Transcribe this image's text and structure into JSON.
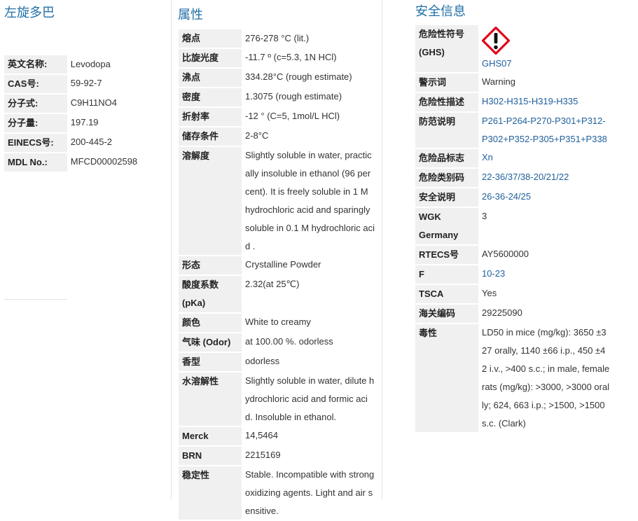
{
  "left": {
    "title": "左旋多巴",
    "rows": [
      {
        "k": "英文名称:",
        "v": "Levodopa"
      },
      {
        "k": "CAS号:",
        "v": "59-92-7"
      },
      {
        "k": "分子式:",
        "v": "C9H11NO4"
      },
      {
        "k": "分子量:",
        "v": "197.19"
      },
      {
        "k": "EINECS号:",
        "v": "200-445-2"
      },
      {
        "k": "MDL No.:",
        "v": "MFCD00002598"
      }
    ]
  },
  "middle": {
    "title": "属性",
    "rows": [
      {
        "k": "熔点",
        "v": "276-278 °C (lit.)"
      },
      {
        "k": "比旋光度",
        "v": "-11.7 º (c=5.3, 1N HCl)"
      },
      {
        "k": "沸点",
        "v": "334.28°C (rough estimate)"
      },
      {
        "k": "密度",
        "v": "1.3075 (rough estimate)"
      },
      {
        "k": "折射率",
        "v": "-12 ° (C=5, 1mol/L HCl)"
      },
      {
        "k": "储存条件",
        "v": "2-8°C"
      },
      {
        "k": "溶解度",
        "v": "Slightly soluble in water, practically insoluble in ethanol (96 per cent). It is freely soluble in 1 M hydrochloric acid and sparingly soluble in 0.1 M hydrochloric acid ."
      },
      {
        "k": "形态",
        "v": "Crystalline Powder"
      },
      {
        "k": "酸度系数(pKa)",
        "v": "2.32(at 25℃)"
      },
      {
        "k": "颜色",
        "v": "White to creamy"
      },
      {
        "k": "气味 (Odor)",
        "v": "at 100.00 %. odorless"
      },
      {
        "k": "香型",
        "v": "odorless"
      },
      {
        "k": "水溶解性",
        "v": "Slightly soluble in water, dilute hydrochloric acid and formic acid. Insoluble in ethanol."
      },
      {
        "k": "Merck",
        "v": "14,5464"
      },
      {
        "k": "BRN",
        "v": "2215169"
      },
      {
        "k": "稳定性",
        "v": "Stable. Incompatible with strong oxidizing agents. Light and air sensitive."
      }
    ]
  },
  "right": {
    "title": "安全信息",
    "ghs": {
      "k": "危险性符号(GHS)",
      "code": "GHS07",
      "icon": "exclamation-mark-pictogram"
    },
    "rows": [
      {
        "k": "警示词",
        "v": "Warning"
      },
      {
        "k": "危险性描述",
        "v": "H302-H315-H319-H335",
        "link": true
      },
      {
        "k": "防范说明",
        "v": "P261-P264-P270-P301+P312-P302+P352-P305+P351+P338",
        "link": true
      },
      {
        "k": "危险品标志",
        "v": "Xn",
        "link": true
      },
      {
        "k": "危险类别码",
        "v": "22-36/37/38-20/21/22",
        "link": true
      },
      {
        "k": "安全说明",
        "v": "26-36-24/25",
        "link": true
      },
      {
        "k": "WGK Germany",
        "v": "3"
      },
      {
        "k": "RTECS号",
        "v": "AY5600000"
      },
      {
        "k": "F",
        "v": "10-23",
        "link": true
      },
      {
        "k": "TSCA",
        "v": "Yes"
      },
      {
        "k": "海关编码",
        "v": "29225090"
      },
      {
        "k": "毒性",
        "v": "LD50 in mice (mg/kg): 3650 ±327 orally, 1140 ±66 i.p., 450 ±42 i.v., >400 s.c.; in male, female rats (mg/kg): >3000, >3000 orally; 624, 663 i.p.; >1500, >1500 s.c. (Clark)"
      }
    ]
  },
  "colors": {
    "heading": "#1f6fa6",
    "link": "#1f5f9b",
    "key_bg": "#f0f0f0",
    "ghs_red": "#e2001a"
  }
}
